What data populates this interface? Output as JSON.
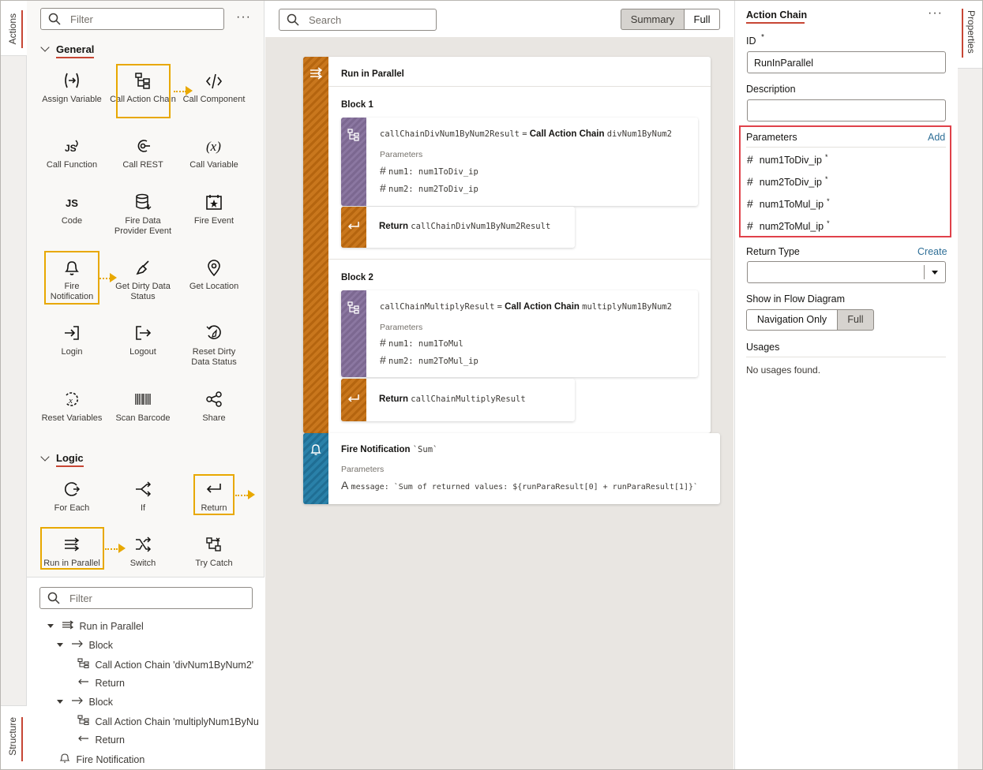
{
  "left_tabs": {
    "actions": "Actions",
    "structure": "Structure"
  },
  "right_tab": "Properties",
  "palette": {
    "filter_placeholder": "Filter",
    "more": "···",
    "general_title": "General",
    "logic_title": "Logic",
    "general_items": [
      "Assign Variable",
      "Call Action Chain",
      "Call Component",
      "Call Function",
      "Call REST",
      "Call Variable",
      "Code",
      "Fire Data Provider Event",
      "Fire Event",
      "Fire Notification",
      "Get Dirty Data Status",
      "Get Location",
      "Login",
      "Logout",
      "Reset Dirty Data Status",
      "Reset Variables",
      "Scan Barcode",
      "Share"
    ],
    "logic_items": [
      "For Each",
      "If",
      "Return",
      "Run in Parallel",
      "Switch",
      "Try Catch"
    ]
  },
  "structure": {
    "filter_placeholder": "Filter",
    "nodes": [
      "Run in Parallel",
      "Block",
      "Call Action Chain  'divNum1ByNum2'",
      "Return",
      "Block",
      "Call Action Chain  'multiplyNum1ByNu",
      "Return",
      "Fire Notification"
    ]
  },
  "canvas": {
    "search_placeholder": "Search",
    "view_summary": "Summary",
    "view_full": "Full",
    "parallel_title": "Run in Parallel",
    "block1": {
      "title": "Block 1",
      "call_result": "callChainDivNum1ByNum2Result",
      "equals": "=",
      "call_label": "Call Action Chain",
      "call_target": "divNum1ByNum2",
      "params_label": "Parameters",
      "params": [
        "num1: num1ToDiv_ip",
        "num2: num2ToDiv_ip"
      ],
      "return_label": "Return",
      "return_value": "callChainDivNum1ByNum2Result"
    },
    "block2": {
      "title": "Block 2",
      "call_result": "callChainMultiplyResult",
      "equals": "=",
      "call_label": "Call Action Chain",
      "call_target": "multiplyNum1ByNum2",
      "params_label": "Parameters",
      "params": [
        "num1: num1ToMul",
        "num2: num2ToMul_ip"
      ],
      "return_label": "Return",
      "return_value": "callChainMultiplyResult"
    },
    "notification": {
      "title": "Fire Notification",
      "summary": "`Sum`",
      "params_label": "Parameters",
      "message": "message: `Sum of returned values: ${runParaResult[0] + runParaResult[1]}`"
    }
  },
  "properties": {
    "title": "Action Chain",
    "more": "···",
    "id_label": "ID",
    "required_mark": "*",
    "id_value": "RunInParallel",
    "description_label": "Description",
    "parameters_label": "Parameters",
    "add_label": "Add",
    "parameters": [
      "num1ToDiv_ip",
      "num2ToDiv_ip",
      "num1ToMul_ip",
      "num2ToMul_ip"
    ],
    "return_type_label": "Return Type",
    "create_label": "Create",
    "show_in_flow_label": "Show in Flow Diagram",
    "nav_only": "Navigation Only",
    "full": "Full",
    "usages_label": "Usages",
    "usages_value": "No usages found."
  },
  "colors": {
    "accent": "#c74634",
    "highlight": "#e8a800",
    "link": "#2f6f97",
    "orange": "#c9771d",
    "purple": "#8b77a1",
    "teal": "#2a81a9"
  }
}
